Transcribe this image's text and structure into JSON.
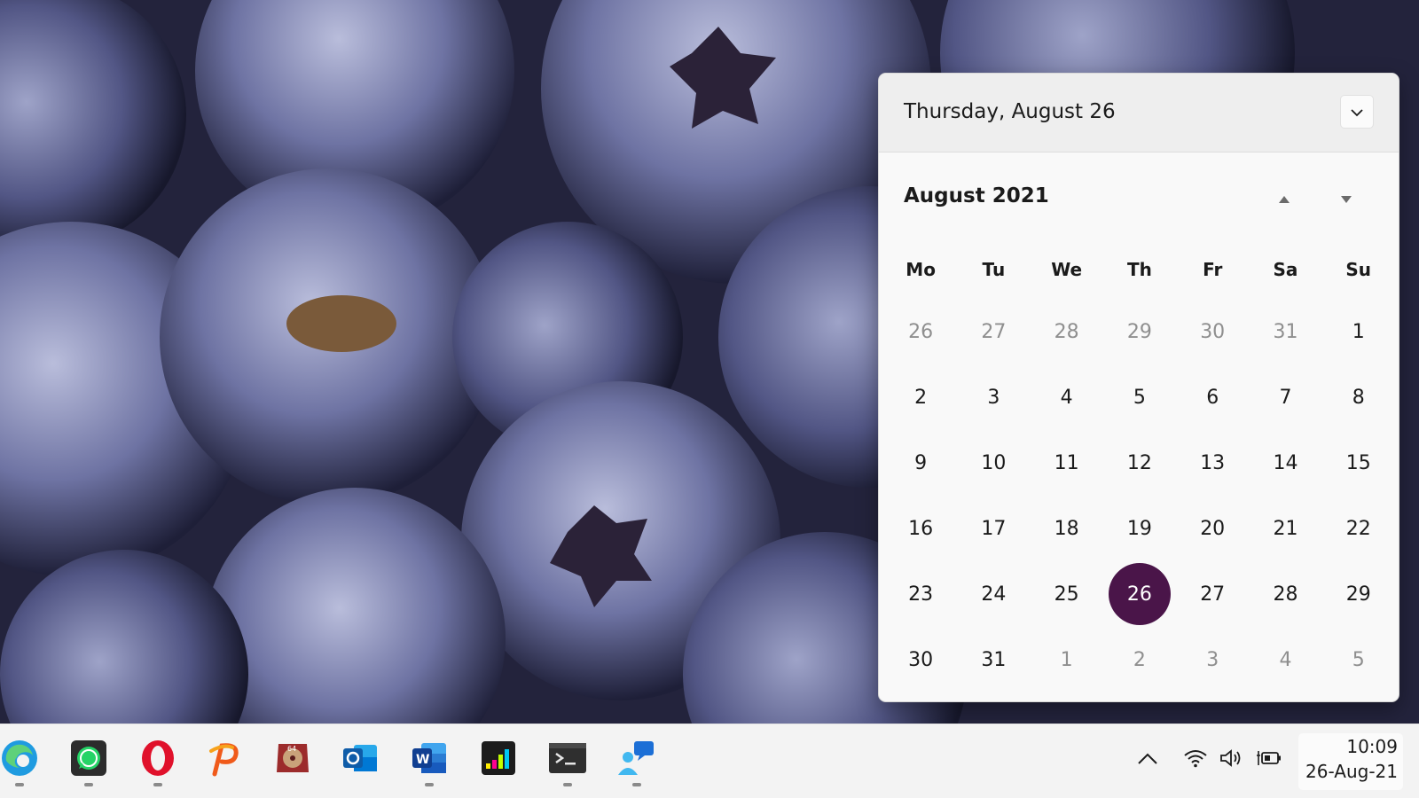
{
  "flyout": {
    "current_date": "Thursday, August 26",
    "month_year": "August 2021",
    "weekdays": [
      "Mo",
      "Tu",
      "We",
      "Th",
      "Fr",
      "Sa",
      "Su"
    ],
    "weeks": [
      [
        {
          "d": "26",
          "o": true
        },
        {
          "d": "27",
          "o": true
        },
        {
          "d": "28",
          "o": true
        },
        {
          "d": "29",
          "o": true
        },
        {
          "d": "30",
          "o": true
        },
        {
          "d": "31",
          "o": true
        },
        {
          "d": "1",
          "o": false
        }
      ],
      [
        {
          "d": "2",
          "o": false
        },
        {
          "d": "3",
          "o": false
        },
        {
          "d": "4",
          "o": false
        },
        {
          "d": "5",
          "o": false
        },
        {
          "d": "6",
          "o": false
        },
        {
          "d": "7",
          "o": false
        },
        {
          "d": "8",
          "o": false
        }
      ],
      [
        {
          "d": "9",
          "o": false
        },
        {
          "d": "10",
          "o": false
        },
        {
          "d": "11",
          "o": false
        },
        {
          "d": "12",
          "o": false
        },
        {
          "d": "13",
          "o": false
        },
        {
          "d": "14",
          "o": false
        },
        {
          "d": "15",
          "o": false
        }
      ],
      [
        {
          "d": "16",
          "o": false
        },
        {
          "d": "17",
          "o": false
        },
        {
          "d": "18",
          "o": false
        },
        {
          "d": "19",
          "o": false
        },
        {
          "d": "20",
          "o": false
        },
        {
          "d": "21",
          "o": false
        },
        {
          "d": "22",
          "o": false
        }
      ],
      [
        {
          "d": "23",
          "o": false
        },
        {
          "d": "24",
          "o": false
        },
        {
          "d": "25",
          "o": false
        },
        {
          "d": "26",
          "o": false,
          "today": true
        },
        {
          "d": "27",
          "o": false
        },
        {
          "d": "28",
          "o": false
        },
        {
          "d": "29",
          "o": false
        }
      ],
      [
        {
          "d": "30",
          "o": false
        },
        {
          "d": "31",
          "o": false
        },
        {
          "d": "1",
          "o": true
        },
        {
          "d": "2",
          "o": true
        },
        {
          "d": "3",
          "o": true
        },
        {
          "d": "4",
          "o": true
        },
        {
          "d": "5",
          "o": true
        }
      ]
    ],
    "accent_color": "#4a1549"
  },
  "taskbar": {
    "apps": [
      {
        "name": "edge-icon",
        "running": true
      },
      {
        "name": "whatsapp-icon",
        "running": true
      },
      {
        "name": "opera-icon",
        "running": true
      },
      {
        "name": "pinterest-like-p-icon",
        "running": false
      },
      {
        "name": "cd-64-icon",
        "running": false
      },
      {
        "name": "outlook-icon",
        "running": false
      },
      {
        "name": "word-icon",
        "running": true
      },
      {
        "name": "deezer-icon",
        "running": false
      },
      {
        "name": "terminal-icon",
        "running": true
      },
      {
        "name": "feedback-icon",
        "running": true
      }
    ],
    "tray": [
      "chevron-up-icon",
      "wifi-icon",
      "volume-icon",
      "battery-charging-icon"
    ],
    "clock": {
      "time": "10:09",
      "date": "26-Aug-21"
    }
  }
}
